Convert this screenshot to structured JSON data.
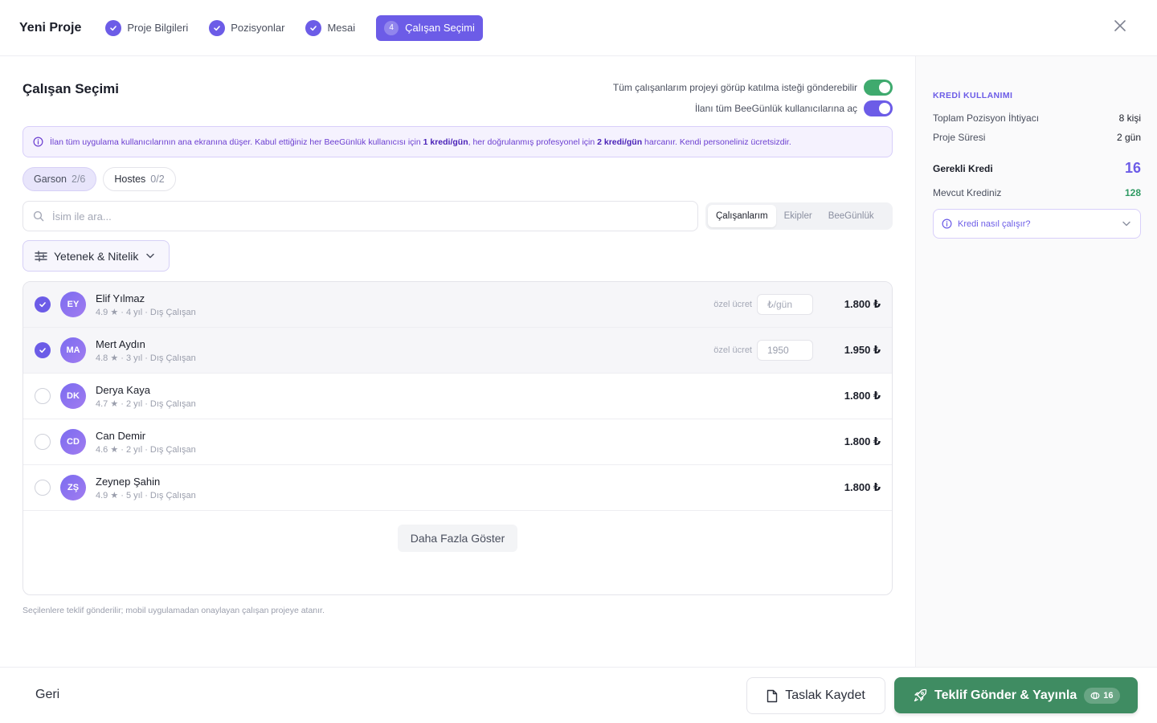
{
  "header": {
    "title": "Yeni Proje",
    "steps": [
      {
        "label": "Proje Bilgileri"
      },
      {
        "label": "Pozisyonlar"
      },
      {
        "label": "Mesai"
      }
    ],
    "active_step": {
      "number": "4",
      "label": "Çalışan Seçimi"
    }
  },
  "main": {
    "title": "Çalışan Seçimi",
    "toggles": [
      {
        "label": "Tüm çalışanlarım projeyi görüp katılma isteği gönderebilir",
        "on": true,
        "color": "#3faa6e"
      },
      {
        "label": "İlanı tüm BeeGünlük kullanıcılarına aç",
        "on": true,
        "color": "#6c5ce7"
      }
    ],
    "info": {
      "part1": "İlan tüm uygulama kullanıcılarının ana ekranına düşer. Kabul ettiğiniz her BeeGünlük kullanıcısı için ",
      "bold1": "1 kredi/gün",
      "part2": ", her doğrulanmış profesyonel için ",
      "bold2": "2 kredi/gün",
      "part3": " harcanır. Kendi personeliniz ücretsizdir."
    },
    "position_tabs": [
      {
        "label": "Garson",
        "count": "2/6",
        "active": true
      },
      {
        "label": "Hostes",
        "count": "0/2",
        "active": false
      }
    ],
    "search_placeholder": "İsim ile ara...",
    "segments": [
      {
        "label": "Çalışanlarım",
        "active": true
      },
      {
        "label": "Ekipler",
        "active": false
      },
      {
        "label": "BeeGünlük",
        "active": false
      }
    ],
    "filter_label": "Yetenek & Nitelik",
    "employees": [
      {
        "initials": "EY",
        "name": "Elif Yılmaz",
        "meta": "4.9 ★ · 4 yıl · Dış Çalışan",
        "selected": true,
        "rate_label": "özel ücret",
        "rate_placeholder": "₺/gün",
        "rate_value": "",
        "price": "1.800 ₺"
      },
      {
        "initials": "MA",
        "name": "Mert Aydın",
        "meta": "4.8 ★ · 3 yıl · Dış Çalışan",
        "selected": true,
        "rate_label": "özel ücret",
        "rate_placeholder": "₺/gün",
        "rate_value": "1950",
        "price": "1.950 ₺"
      },
      {
        "initials": "DK",
        "name": "Derya Kaya",
        "meta": "4.7 ★ · 2 yıl · Dış Çalışan",
        "selected": false,
        "price": "1.800 ₺"
      },
      {
        "initials": "CD",
        "name": "Can Demir",
        "meta": "4.6 ★ · 2 yıl · Dış Çalışan",
        "selected": false,
        "price": "1.800 ₺"
      },
      {
        "initials": "ZŞ",
        "name": "Zeynep Şahin",
        "meta": "4.9 ★ · 5 yıl · Dış Çalışan",
        "selected": false,
        "price": "1.800 ₺"
      }
    ],
    "more_label": "Daha Fazla Göster",
    "note": "Seçilenlere teklif gönderilir; mobil uygulamadan onaylayan çalışan projeye atanır."
  },
  "sidebar": {
    "heading": "KREDİ KULLANIMI",
    "total_positions_label": "Toplam Pozisyon İhtiyacı",
    "total_positions_value": "8 kişi",
    "duration_label": "Proje Süresi",
    "duration_value": "2 gün",
    "required_label": "Gerekli Kredi",
    "required_value": "16",
    "current_label": "Mevcut Krediniz",
    "current_value": "128",
    "accordion_label": "Kredi nasıl çalışır?"
  },
  "footer": {
    "back_label": "Geri",
    "draft_label": "Taslak Kaydet",
    "publish_label": "Teklif Gönder & Yayınla",
    "publish_badge": "16"
  },
  "colors": {
    "accent": "#6c5ce7",
    "success": "#3f8c62"
  }
}
